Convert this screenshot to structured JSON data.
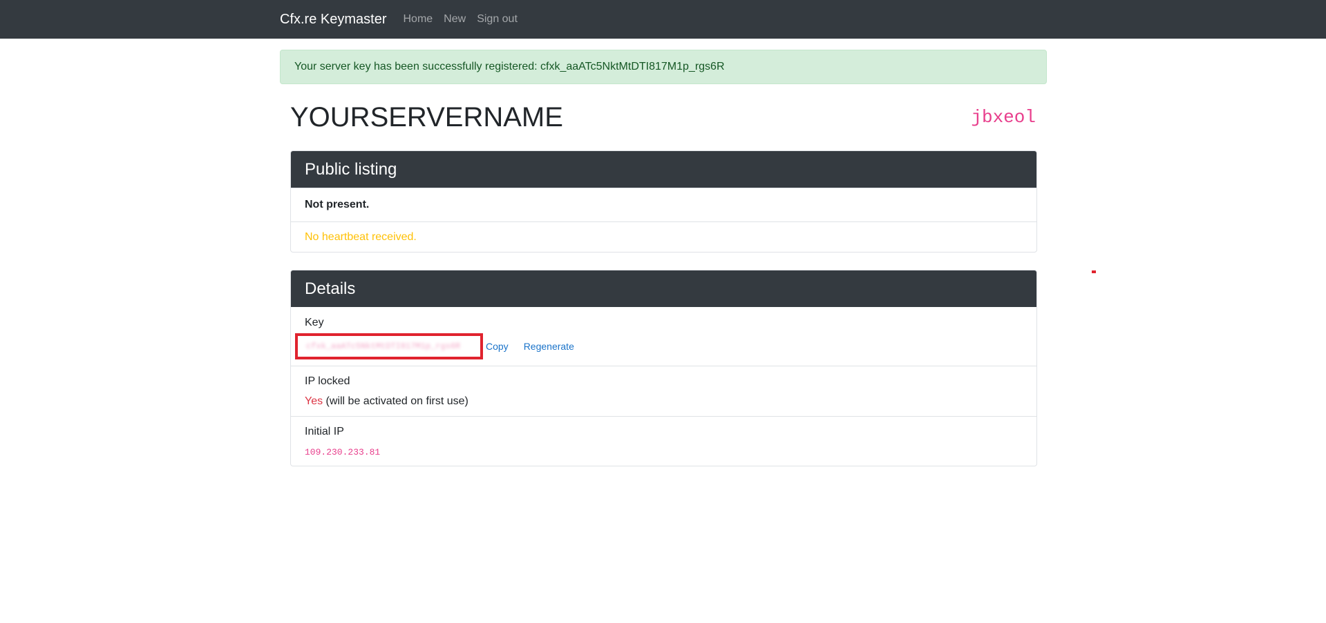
{
  "navbar": {
    "brand": "Cfx.re Keymaster",
    "links": [
      "Home",
      "New",
      "Sign out"
    ]
  },
  "alert": {
    "text": "Your server key has been successfully registered: cfxk_aaATc5NktMtDTI817M1p_rgs6R"
  },
  "server": {
    "name": "YOURSERVERNAME",
    "code": "jbxeol"
  },
  "public_listing": {
    "title": "Public listing",
    "status": "Not present.",
    "heartbeat": "No heartbeat received."
  },
  "details": {
    "title": "Details",
    "key_label": "Key",
    "key_value": "cfxk_aaATc5NktMtDTI817M1p_rgs6R",
    "copy_label": "Copy",
    "regenerate_label": "Regenerate",
    "ip_locked_label": "IP locked",
    "ip_locked_value": "Yes",
    "ip_locked_note": " (will be activated on first use)",
    "initial_ip_label": "Initial IP",
    "initial_ip_value": "109.230.233.81"
  },
  "colors": {
    "navbar_bg": "#343a40",
    "alert_bg": "#d4edda",
    "accent_pink": "#e83e8c",
    "warning": "#ffc107",
    "danger": "#dc3545",
    "highlight_red": "#e0232e"
  }
}
